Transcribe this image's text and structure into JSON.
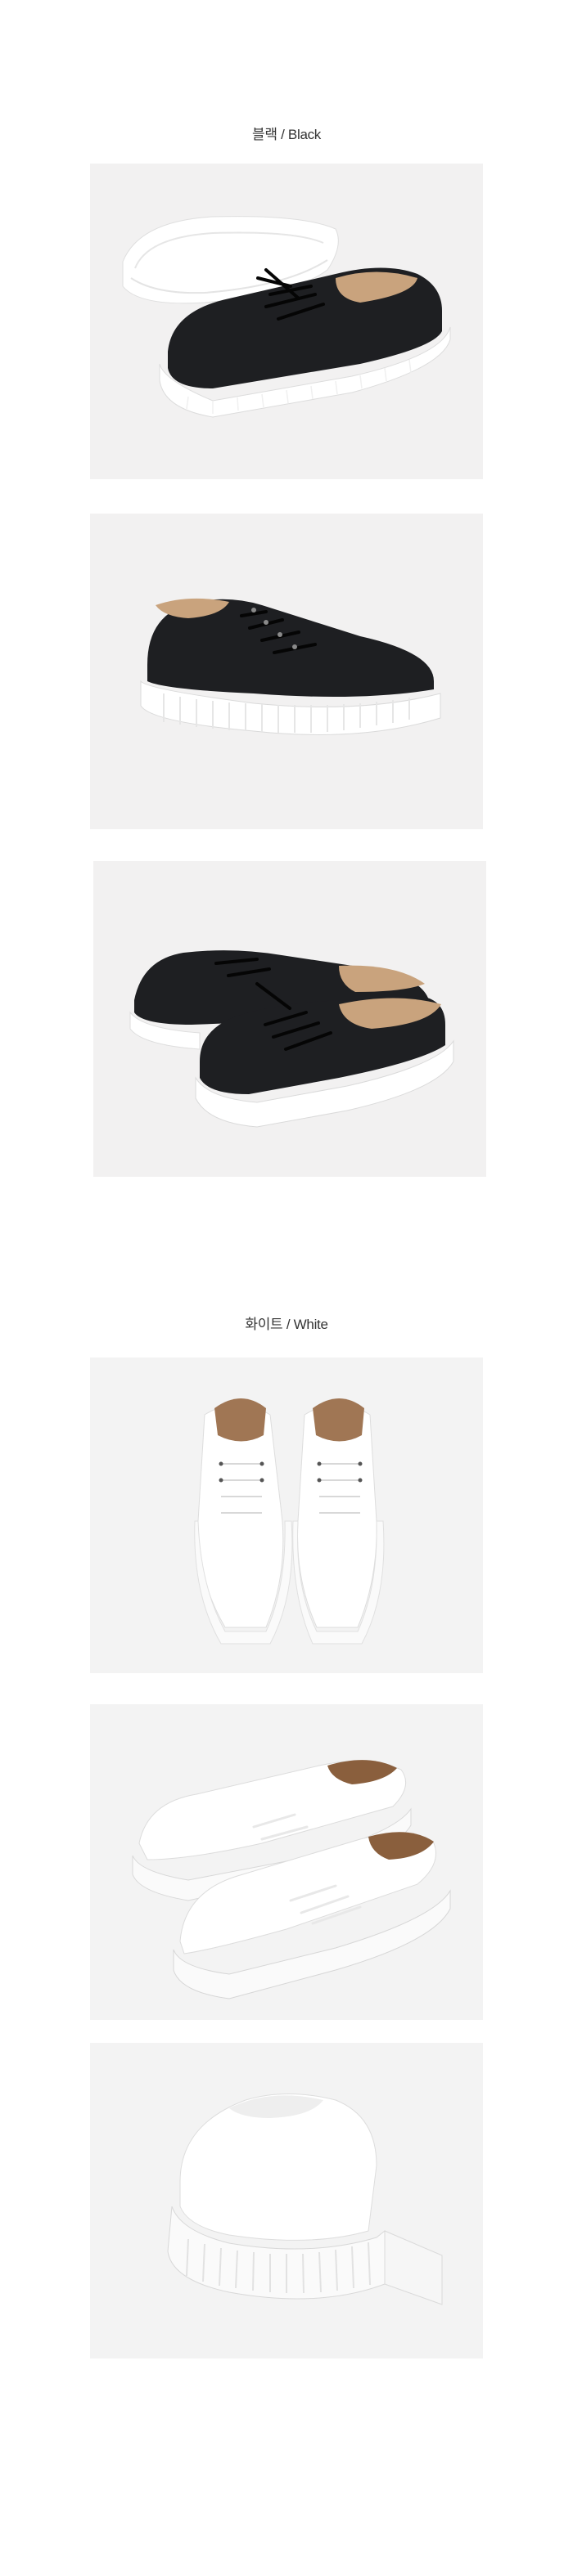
{
  "sections": [
    {
      "title": "블랙 / Black",
      "color": "#1e1f22",
      "photos": [
        {
          "name": "black-sneakers-pair-sole-view",
          "view": "pair-sole"
        },
        {
          "name": "black-sneaker-side-view",
          "view": "single-side"
        },
        {
          "name": "black-sneakers-pair-front-view",
          "view": "pair-front"
        }
      ]
    },
    {
      "title": "화이트 / White",
      "color": "#f6f6f6",
      "photos": [
        {
          "name": "white-sneakers-top-view",
          "view": "top"
        },
        {
          "name": "white-sneakers-pair-angle-view",
          "view": "pair-angle"
        },
        {
          "name": "white-sneaker-heel-view",
          "view": "heel"
        }
      ]
    }
  ],
  "colors": {
    "background": "#f2f1f1",
    "leather_black": "#1e1f22",
    "leather_white": "#f6f6f6",
    "lining": "#c9a37d",
    "sole": "#ffffff"
  }
}
